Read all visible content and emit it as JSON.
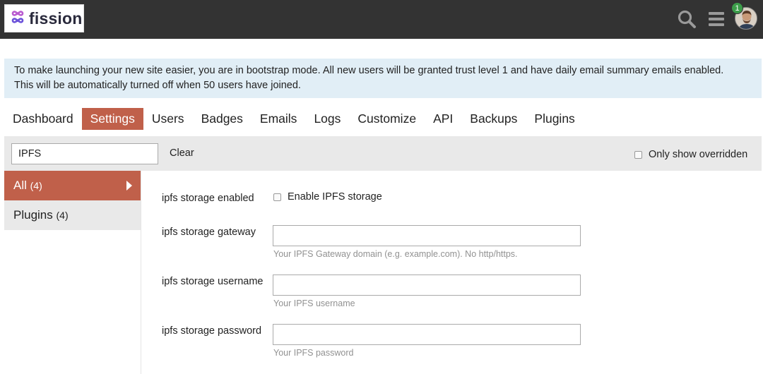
{
  "header": {
    "logo_text": "fission",
    "notification_count": "1",
    "icons": [
      "fission-logo-icon",
      "search-icon",
      "hamburger-menu-icon",
      "user-avatar"
    ]
  },
  "notice": {
    "line1": "To make launching your new site easier, you are in bootstrap mode. All new users will be granted trust level 1 and have daily email summary emails enabled.",
    "line2": "This will be automatically turned off when 50 users have joined."
  },
  "nav": {
    "items": [
      {
        "label": "Dashboard"
      },
      {
        "label": "Settings",
        "active": true
      },
      {
        "label": "Users"
      },
      {
        "label": "Badges"
      },
      {
        "label": "Emails"
      },
      {
        "label": "Logs"
      },
      {
        "label": "Customize"
      },
      {
        "label": "API"
      },
      {
        "label": "Backups"
      },
      {
        "label": "Plugins"
      }
    ]
  },
  "filter": {
    "value": "IPFS",
    "clear_label": "Clear",
    "only_overridden_label": "Only show overridden"
  },
  "sidebar": {
    "items": [
      {
        "label": "All",
        "count": "(4)",
        "active": true
      },
      {
        "label": "Plugins",
        "count": "(4)"
      }
    ]
  },
  "settings": [
    {
      "label": "ipfs storage enabled",
      "checkbox_label": "Enable IPFS storage",
      "checked": false
    },
    {
      "label": "ipfs storage gateway",
      "value": "",
      "help": "Your IPFS Gateway domain (e.g. example.com). No http/https."
    },
    {
      "label": "ipfs storage username",
      "value": "",
      "help": "Your IPFS username"
    },
    {
      "label": "ipfs storage password",
      "value": "",
      "help": "Your IPFS password"
    }
  ],
  "colors": {
    "header_bg": "#333333",
    "accent": "#c0604a",
    "notice_bg": "#e1eef6",
    "filter_bg": "#e9e9e9",
    "badge_green": "#3c9d4a"
  }
}
